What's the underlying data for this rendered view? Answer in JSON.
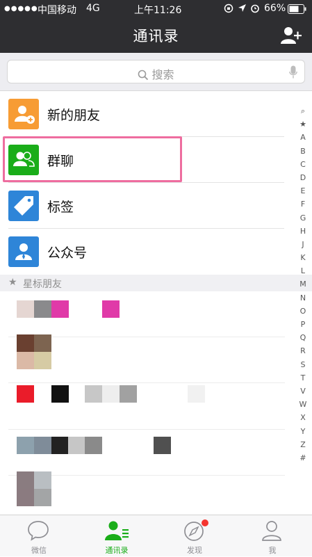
{
  "status_bar": {
    "signal": "●●●●●",
    "carrier": "中国移动",
    "network": "4G",
    "time": "上午11:26",
    "battery": "66%"
  },
  "nav": {
    "title": "通讯录"
  },
  "search": {
    "placeholder": "搜索"
  },
  "entries": [
    {
      "label": "新的朋友",
      "icon": "new-friend-icon",
      "color": "#f79c34"
    },
    {
      "label": "群聊",
      "icon": "group-chat-icon",
      "color": "#1aad19"
    },
    {
      "label": "标签",
      "icon": "tag-icon",
      "color": "#2e85d8"
    },
    {
      "label": "公众号",
      "icon": "official-account-icon",
      "color": "#2e85d8"
    }
  ],
  "section": {
    "star": "★",
    "title": "星标朋友"
  },
  "index_letters": [
    "⌕",
    "★",
    "A",
    "B",
    "C",
    "D",
    "E",
    "F",
    "G",
    "H",
    "J",
    "K",
    "L",
    "M",
    "N",
    "O",
    "P",
    "Q",
    "R",
    "S",
    "T",
    "V",
    "W",
    "X",
    "Y",
    "Z",
    "#"
  ],
  "tabs": [
    {
      "label": "微信",
      "icon": "chat-icon",
      "active": false
    },
    {
      "label": "通讯录",
      "icon": "contacts-icon",
      "active": true
    },
    {
      "label": "发现",
      "icon": "compass-icon",
      "active": false
    },
    {
      "label": "我",
      "icon": "person-icon",
      "active": false
    }
  ],
  "colors": {
    "accent": "#1aad19",
    "header": "#2e2e31",
    "highlight": "#ee6d9f"
  }
}
